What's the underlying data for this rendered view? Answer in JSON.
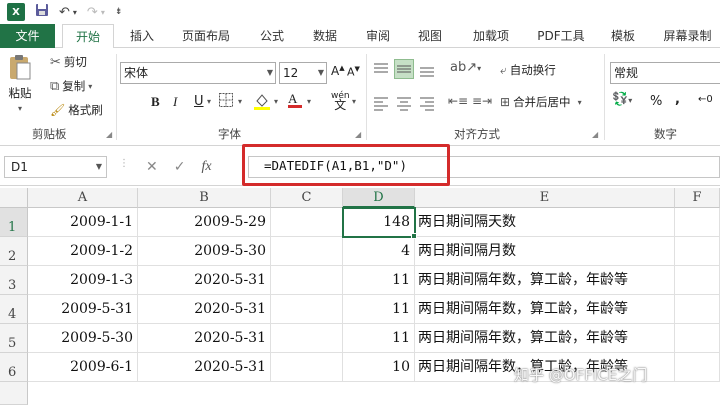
{
  "qat": {
    "app_icon": "X",
    "save_icon": "save-icon",
    "undo_icon": "undo-icon",
    "redo_icon": "redo-icon"
  },
  "tabs": [
    {
      "label": "文件"
    },
    {
      "label": "开始"
    },
    {
      "label": "插入"
    },
    {
      "label": "页面布局"
    },
    {
      "label": "公式"
    },
    {
      "label": "数据"
    },
    {
      "label": "审阅"
    },
    {
      "label": "视图"
    },
    {
      "label": "加载项"
    },
    {
      "label": "PDF工具"
    },
    {
      "label": "模板"
    },
    {
      "label": "屏幕录制"
    }
  ],
  "ribbon": {
    "clipboard": {
      "paste": "粘贴",
      "cut": "剪切",
      "copy": "复制",
      "format_painter": "格式刷",
      "group": "剪贴板"
    },
    "font": {
      "font_name": "宋体",
      "font_size": "12",
      "bold": "B",
      "italic": "I",
      "underline": "U",
      "wen": "wén",
      "group": "字体"
    },
    "alignment": {
      "wrap": "自动换行",
      "merge": "合并后居中",
      "group": "对齐方式"
    },
    "number": {
      "format": "常规",
      "percent": "%",
      "group": "数字"
    }
  },
  "formula_bar": {
    "name_box": "D1",
    "formula": "=DATEDIF(A1,B1,\"D\")",
    "cancel": "✕",
    "enter": "✓",
    "fx": "fx"
  },
  "columns": [
    "A",
    "B",
    "C",
    "D",
    "E",
    "F"
  ],
  "rows": [
    {
      "num": "1",
      "a": "2009-1-1",
      "b": "2009-5-29",
      "d": "148",
      "e": "两日期间隔天数"
    },
    {
      "num": "2",
      "a": "2009-1-2",
      "b": "2009-5-30",
      "d": "4",
      "e": "两日期间隔月数"
    },
    {
      "num": "3",
      "a": "2009-1-3",
      "b": "2020-5-31",
      "d": "11",
      "e": "两日期间隔年数，算工龄，年龄等"
    },
    {
      "num": "4",
      "a": "2009-5-31",
      "b": "2020-5-31",
      "d": "11",
      "e": "两日期间隔年数，算工龄，年龄等"
    },
    {
      "num": "5",
      "a": "2009-5-30",
      "b": "2020-5-31",
      "d": "11",
      "e": "两日期间隔年数，算工龄，年龄等"
    },
    {
      "num": "6",
      "a": "2009-6-1",
      "b": "2020-5-31",
      "d": "10",
      "e": "两日期间隔年数，算工龄，年龄等"
    }
  ],
  "watermark": "知乎 @OFFICE之门",
  "colors": {
    "excel_green": "#217346",
    "highlight_red": "#d42b2b"
  }
}
